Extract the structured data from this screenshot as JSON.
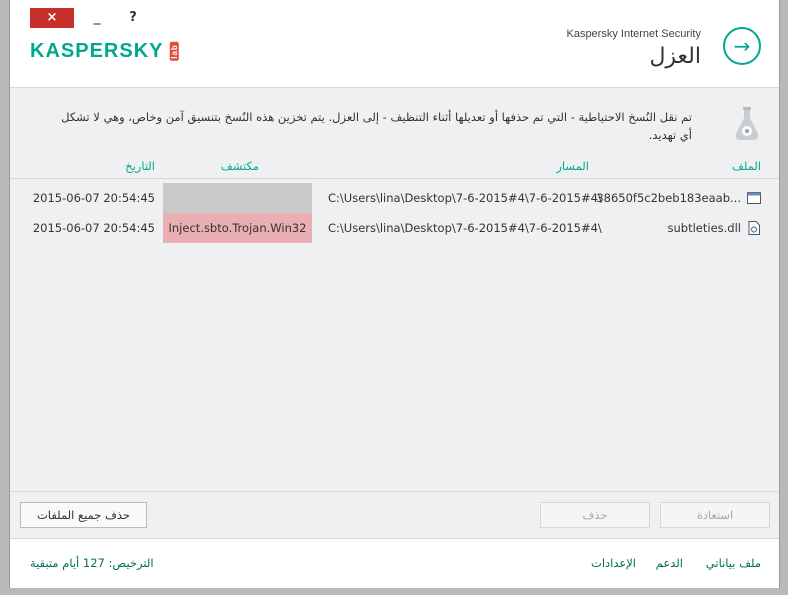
{
  "titlebar": {
    "close": "×",
    "minimize": "_",
    "help": "?"
  },
  "header": {
    "logo": "KASPERSKY",
    "logo_suffix": "lab",
    "product": "Kaspersky Internet Security",
    "title": "العزل",
    "back": "→"
  },
  "info": {
    "text": "تم نقل النُسخ الاحتياطية - التي تم حذفها أو تعديلها أثناء التنظيف - إلى العزل. يتم تخزين هذه النُسخ بتنسيق آمن وخاص، وهي لا تشكل أي تهديد."
  },
  "table": {
    "columns": {
      "file": "الملف",
      "path": "المسار",
      "detector": "مكتشف",
      "date": "التاريخ"
    },
    "rows": [
      {
        "file": "38650f5c2beb183eaab...",
        "path": "C:\\Users\\lina\\Desktop\\7-6-2015#4\\7-6-2015#4\\...",
        "detector": "",
        "date": "2015-06-07 20:54:45"
      },
      {
        "file": "subtleties.dll",
        "path": "C:\\Users\\lina\\Desktop\\7-6-2015#4\\7-6-2015#4\\...",
        "detector": "Inject.sbto.Trojan.Win32",
        "date": "2015-06-07 20:54:45"
      }
    ]
  },
  "actions": {
    "restore": "استعادة",
    "delete": "حذف",
    "delete_all": "حذف جميع الملفات"
  },
  "footer": {
    "profile": "ملف بياناتي",
    "support": "الدعم",
    "settings": "الإعدادات",
    "license_label": "الترخيص:",
    "license_days": "127",
    "license_suffix": "أيام متبقية"
  },
  "colors": {
    "accent": "#00a88e",
    "close": "#c7302b",
    "detected_bg": "#eaafb2"
  }
}
